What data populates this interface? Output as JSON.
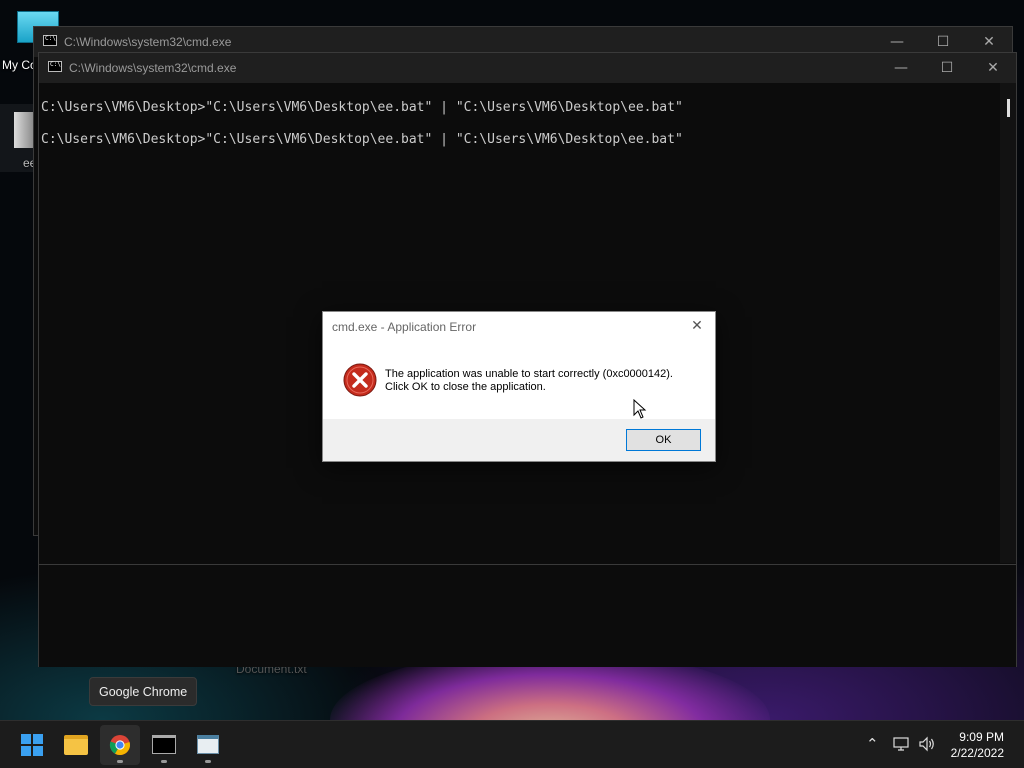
{
  "desktop": {
    "icons": [
      {
        "label": "My Co",
        "icon": "computer-icon"
      },
      {
        "label": "ee",
        "icon": "batch-file-icon"
      }
    ],
    "background_file_label": "Document.txt"
  },
  "back_window": {
    "title": "C:\\Windows\\system32\\cmd.exe"
  },
  "front_window": {
    "title": "C:\\Windows\\system32\\cmd.exe",
    "lines": [
      "C:\\Users\\VM6\\Desktop>\"C:\\Users\\VM6\\Desktop\\ee.bat\" | \"C:\\Users\\VM6\\Desktop\\ee.bat\"",
      "C:\\Users\\VM6\\Desktop>\"C:\\Users\\VM6\\Desktop\\ee.bat\" | \"C:\\Users\\VM6\\Desktop\\ee.bat\""
    ]
  },
  "dialog": {
    "title": "cmd.exe - Application Error",
    "message_line1": "The application was unable to start correctly (0xc0000142).",
    "message_line2": "Click OK to close the application.",
    "ok_label": "OK",
    "icon": "error-icon"
  },
  "tooltip": {
    "text": "Google Chrome"
  },
  "taskbar": {
    "items": [
      "start-icon",
      "file-explorer-icon",
      "chrome-icon",
      "terminal-icon",
      "notepad-icon"
    ],
    "time": "9:09 PM",
    "date": "2/22/2022"
  },
  "colors": {
    "terminal_bg": "#0c0c0c",
    "terminal_text": "#cccccc",
    "error_red": "#c42b1c",
    "accent": "#0078d7"
  }
}
